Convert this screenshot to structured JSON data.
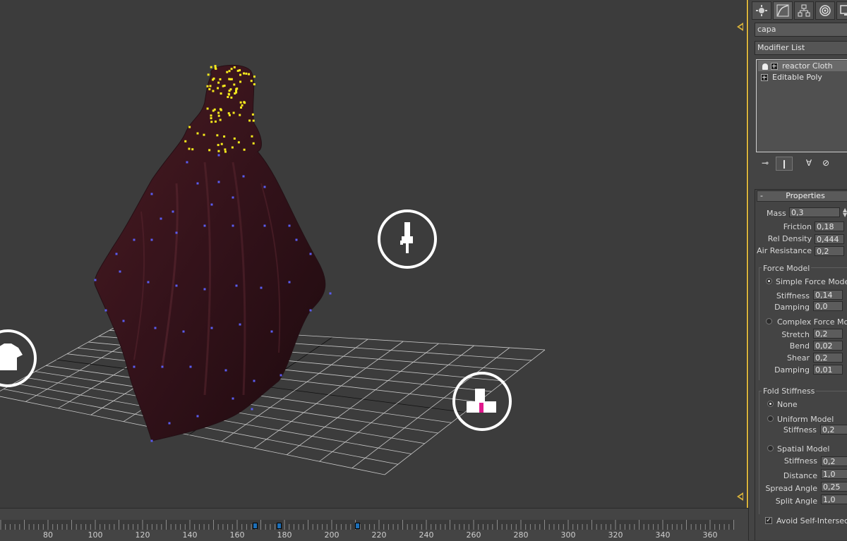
{
  "panel": {
    "object_name": "capa",
    "modifier_list_label": "Modifier List",
    "stack": [
      {
        "label": "reactor Cloth",
        "selected": true
      },
      {
        "label": "Editable Poly",
        "selected": false
      }
    ],
    "properties": {
      "title": "Properties",
      "mass_label": "Mass",
      "mass": "0,3",
      "friction_label": "Friction",
      "friction": "0,18",
      "rel_density_label": "Rel Density",
      "rel_density": "0,444",
      "air_resistance_label": "Air Resistance",
      "air_resistance": "0,2",
      "force_model": {
        "title": "Force Model",
        "simple_label": "Simple Force Model",
        "simple_selected": true,
        "stiffness_label": "Stiffness",
        "stiffness": "0,14",
        "damping_label": "Damping",
        "damping": "0,0",
        "complex_label": "Complex Force Model",
        "stretch_label": "Stretch",
        "stretch": "0,2",
        "bend_label": "Bend",
        "bend": "0,02",
        "shear_label": "Shear",
        "shear": "0,2",
        "c_damping_label": "Damping",
        "c_damping": "0,01"
      },
      "fold_stiffness": {
        "title": "Fold Stiffness",
        "none_label": "None",
        "none_selected": true,
        "uniform_label": "Uniform Model",
        "uniform_stiffness_label": "Stiffness",
        "uniform_stiffness": "0,2",
        "spatial_label": "Spatial Model",
        "spatial_stiffness_label": "Stiffness",
        "spatial_stiffness": "0,2",
        "distance_label": "Distance",
        "distance": "1,0",
        "spread_angle_label": "Spread Angle",
        "spread_angle": "0,25",
        "split_angle_label": "Split Angle",
        "split_angle": "1,0"
      },
      "avoid_self_intersections_label": "Avoid Self-Intersections",
      "avoid_self_intersections": true
    }
  },
  "timeline": {
    "labels": [
      "80",
      "100",
      "120",
      "140",
      "160",
      "180",
      "200",
      "220",
      "240",
      "260",
      "280",
      "300",
      "320",
      "340",
      "360"
    ]
  },
  "colors": {
    "viewport_bg": "#3c3c3c",
    "cloth": "#3a1418",
    "vertex_selected": "#f4e81c",
    "vertex": "#5a5cf0",
    "active_border": "#d9b23a"
  }
}
